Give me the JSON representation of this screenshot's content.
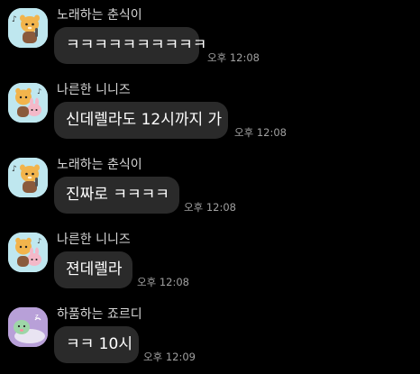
{
  "colors": {
    "background": "#000000",
    "bubble": "#2a2a2a",
    "sender_text": "#d6d6d6",
    "message_text": "#ffffff",
    "time_text": "#a0a0a0"
  },
  "messages": [
    {
      "avatar_icon": "choonsik-singing-avatar-icon",
      "sender": "노래하는 춘식이",
      "text": "ㅋㅋㅋㅋㅋㅋㅋㅋㅋㅋ",
      "time": "오후 12:08"
    },
    {
      "avatar_icon": "ninize-avatar-icon",
      "sender": "나른한 니니즈",
      "text": "신데렐라도 12시까지 가",
      "time": "오후 12:08"
    },
    {
      "avatar_icon": "choonsik-singing-avatar-icon",
      "sender": "노래하는 춘식이",
      "text": "진짜로 ㅋㅋㅋㅋ",
      "time": "오후 12:08"
    },
    {
      "avatar_icon": "ninize-avatar-icon",
      "sender": "나른한 니니즈",
      "text": "젼데렐라",
      "time": "오후 12:08"
    },
    {
      "avatar_icon": "jordy-avatar-icon",
      "sender": "하품하는 죠르디",
      "text": "ㅋㅋ 10시",
      "time": "오후 12:09"
    }
  ]
}
